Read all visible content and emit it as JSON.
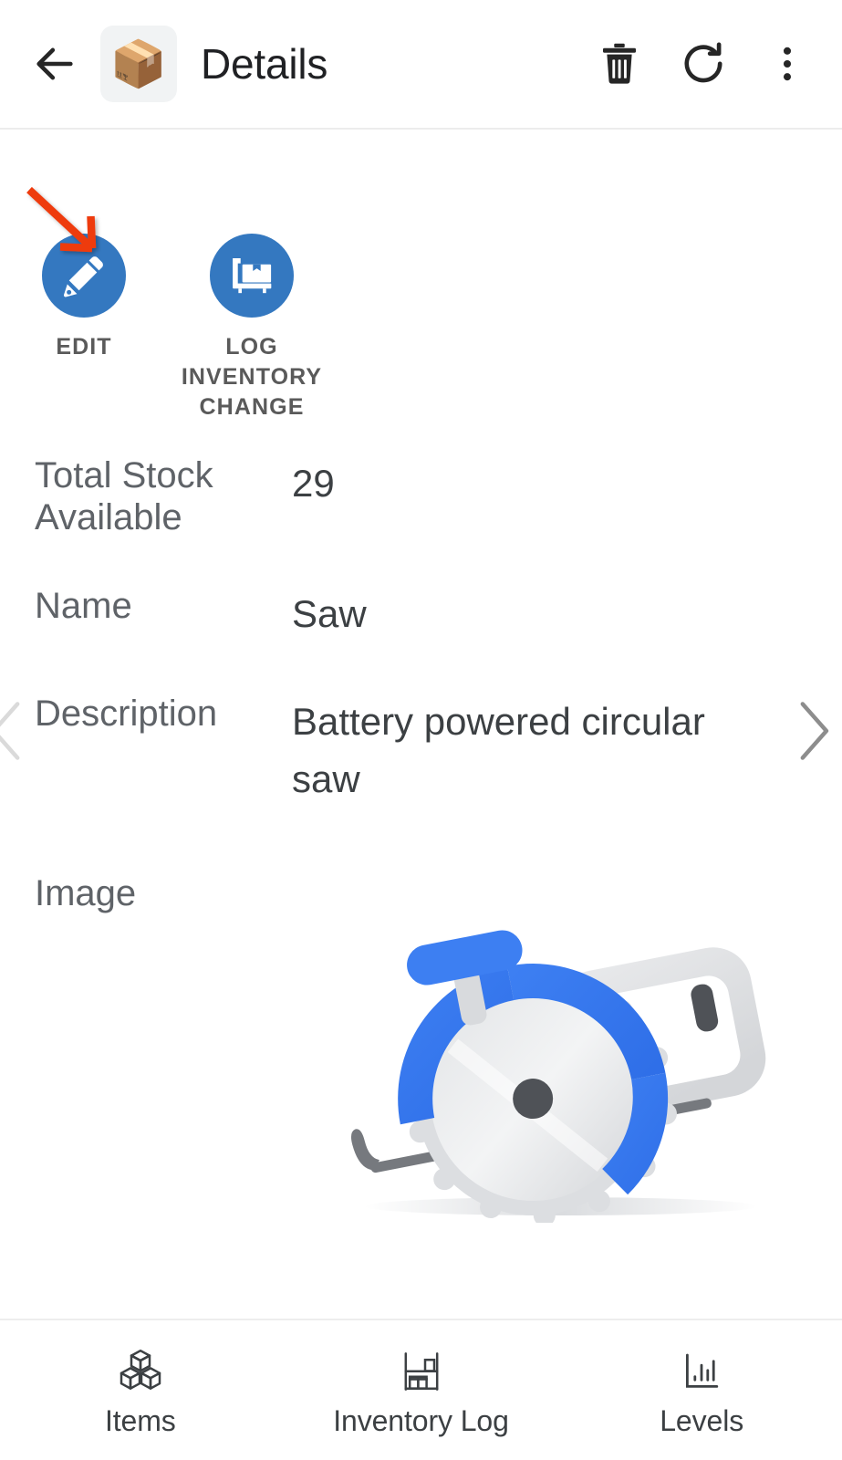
{
  "header": {
    "back_icon": "arrow-left-icon",
    "app_icon": "package-box-emoji",
    "app_icon_glyph": "📦",
    "title": "Details",
    "actions": [
      {
        "name": "delete",
        "icon": "trash-icon",
        "label": "Delete"
      },
      {
        "name": "refresh",
        "icon": "refresh-icon",
        "label": "Refresh"
      },
      {
        "name": "overflow",
        "icon": "more-vertical-icon",
        "label": "More options"
      }
    ]
  },
  "actions": {
    "edit": {
      "label": "EDIT",
      "icon": "pencil-icon"
    },
    "log_inventory_change": {
      "label": "LOG INVENTORY CHANGE",
      "icon": "hand-truck-box-icon"
    }
  },
  "annotation": {
    "type": "arrow",
    "color": "#ee3b11",
    "points_to": "edit-action-button"
  },
  "fields": [
    {
      "label": "Total Stock Available",
      "value": "29"
    },
    {
      "label": "Name",
      "value": "Saw"
    },
    {
      "label": "Description",
      "value": "Battery powered circular saw"
    },
    {
      "label": "Image",
      "value": ""
    }
  ],
  "record_nav": {
    "prev_icon": "chevron-left-icon",
    "next_icon": "chevron-right-icon"
  },
  "image_field": {
    "alt": "circular-saw-illustration"
  },
  "bottom_nav": {
    "items": [
      {
        "label": "Items",
        "icon": "cubes-icon"
      },
      {
        "label": "Inventory Log",
        "icon": "shelf-icon"
      },
      {
        "label": "Levels",
        "icon": "bar-chart-icon"
      }
    ]
  },
  "colors": {
    "accent_blue": "#3478c0",
    "saw_blue": "#3d7ff2",
    "annotation_red": "#ee3b11",
    "label_gray": "#5f6368",
    "value_gray": "#3c4043"
  }
}
